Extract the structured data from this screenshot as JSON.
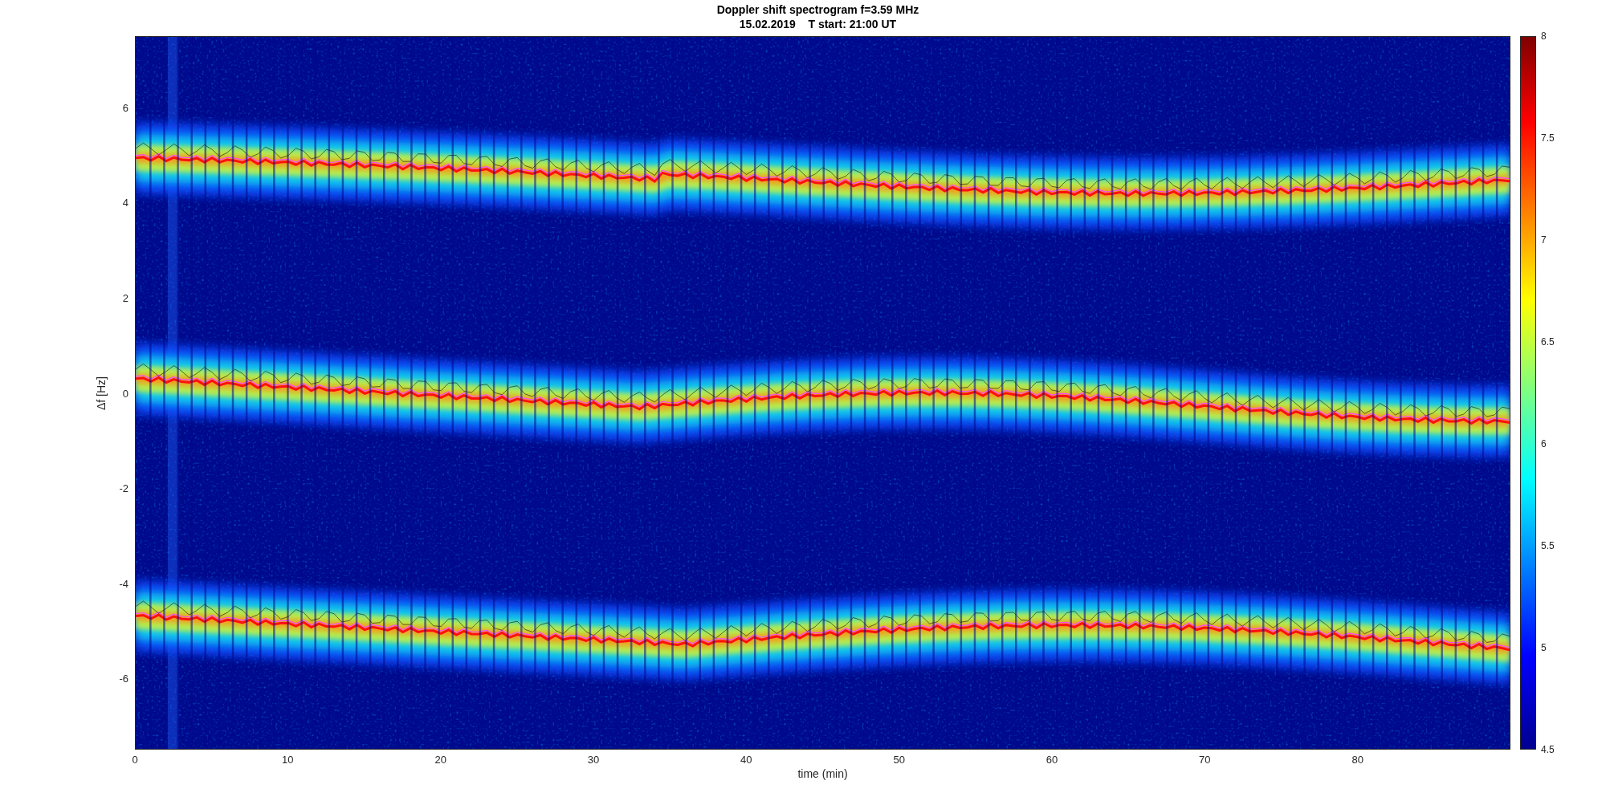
{
  "figure": {
    "title": "Doppler shift spectrogram f=3.59 MHz",
    "subtitle": "15.02.2019    T start: 21:00 UT",
    "xlabel": "time (min)",
    "ylabel": "Δf [Hz]",
    "xticks": [
      "0",
      "10",
      "20",
      "30",
      "40",
      "50",
      "60",
      "70",
      "80"
    ],
    "yticks": [
      "6",
      "4",
      "2",
      "0",
      "-2",
      "-4",
      "-6"
    ],
    "colorbar_ticks": [
      "8",
      "7.5",
      "7",
      "6.5",
      "6",
      "5.5",
      "5",
      "4.5"
    ]
  }
}
